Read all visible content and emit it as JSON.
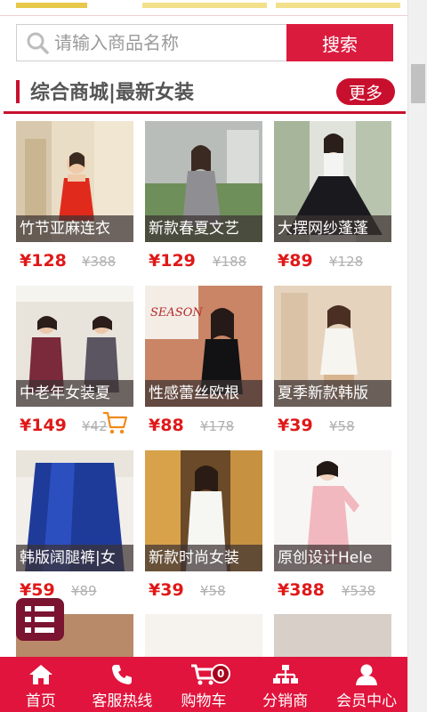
{
  "search": {
    "placeholder": "请输入商品名称",
    "button_label": "搜索"
  },
  "section": {
    "title": "综合商城|最新女装",
    "more_label": "更多"
  },
  "products": [
    {
      "name": "竹节亚麻连衣",
      "price": "¥128",
      "old_price": "¥388"
    },
    {
      "name": "新款春夏文艺",
      "price": "¥129",
      "old_price": "¥188"
    },
    {
      "name": "大摆网纱蓬蓬",
      "price": "¥89",
      "old_price": "¥128"
    },
    {
      "name": "中老年女装夏",
      "price": "¥149",
      "old_price": "¥42"
    },
    {
      "name": "性感蕾丝欧根",
      "price": "¥88",
      "old_price": "¥178"
    },
    {
      "name": "夏季新款韩版",
      "price": "¥39",
      "old_price": "¥58"
    },
    {
      "name": "韩版阔腿裤|女",
      "price": "¥59",
      "old_price": "¥89"
    },
    {
      "name": "新款时尚女装",
      "price": "¥39",
      "old_price": "¥58"
    },
    {
      "name": "原创设计Hele",
      "price": "¥388",
      "old_price": "¥538"
    }
  ],
  "image_text": {
    "season": "SEASON"
  },
  "cart_count": "0",
  "nav": [
    {
      "label": "首页",
      "icon": "home-icon"
    },
    {
      "label": "客服热线",
      "icon": "phone-icon"
    },
    {
      "label": "购物车",
      "icon": "cart-icon"
    },
    {
      "label": "分销商",
      "icon": "org-chart-icon"
    },
    {
      "label": "会员中心",
      "icon": "user-icon"
    }
  ],
  "colors": {
    "brand": "#e0143c",
    "price": "#e01818",
    "accent": "#c8102e"
  }
}
